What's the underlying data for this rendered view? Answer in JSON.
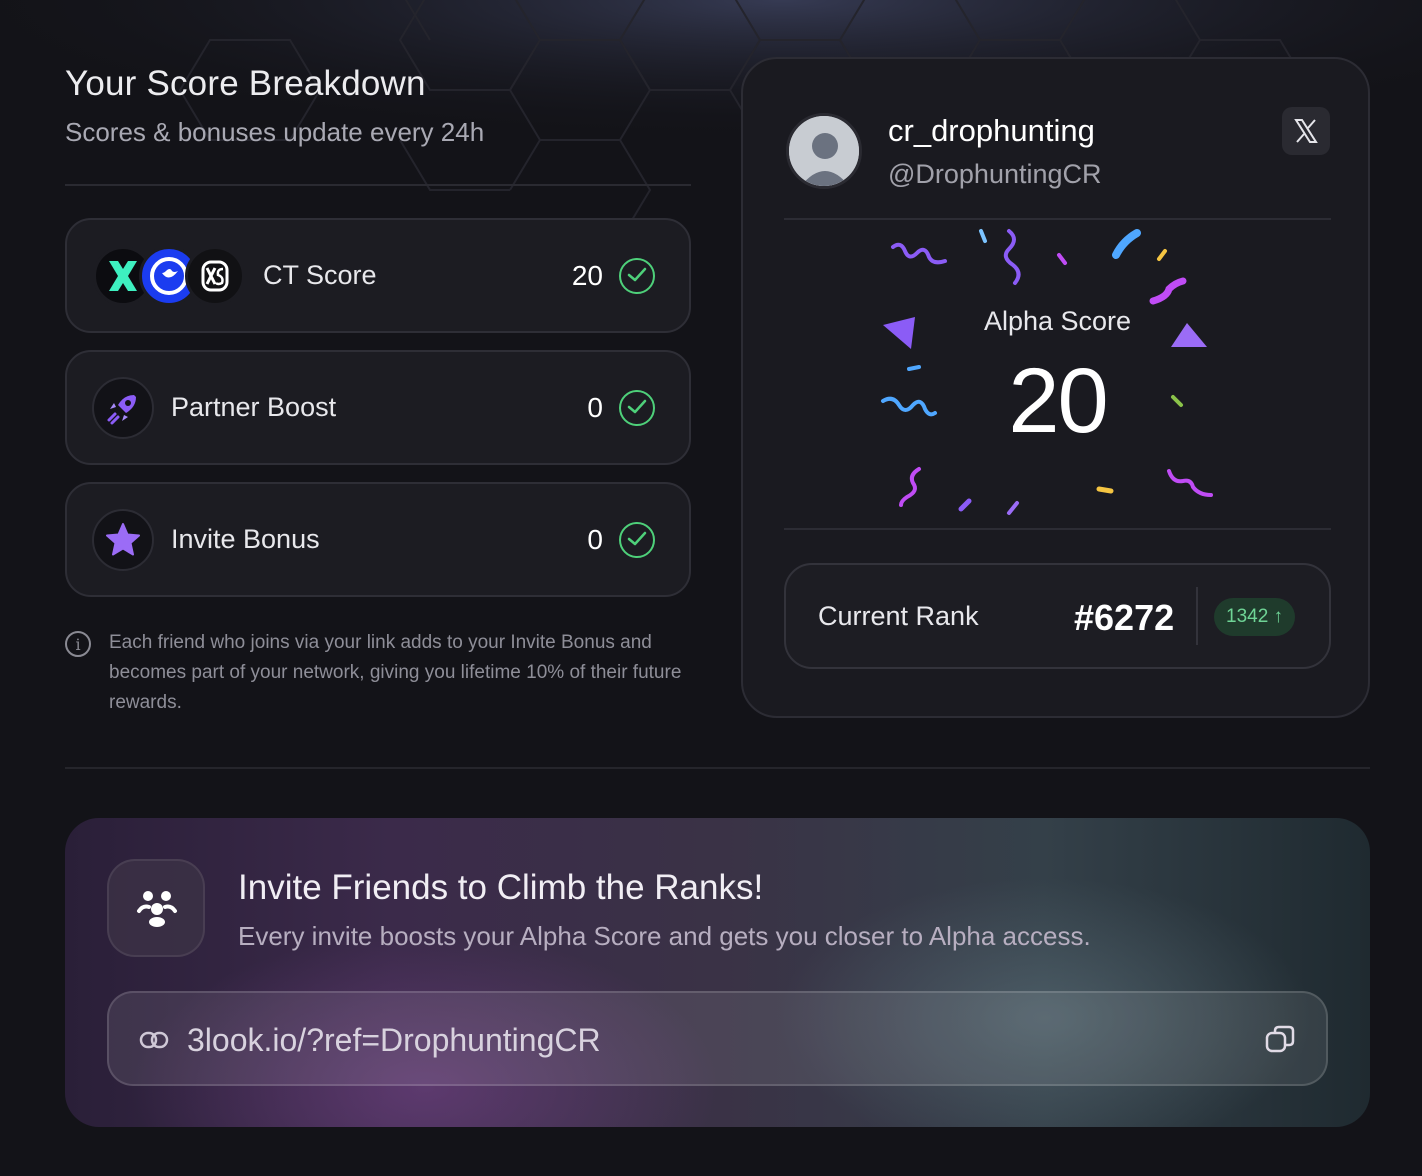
{
  "breakdown": {
    "title": "Your Score Breakdown",
    "subtitle": "Scores & bonuses update every 24h",
    "rows": [
      {
        "label": "CT Score",
        "value": "20"
      },
      {
        "label": "Partner Boost",
        "value": "0"
      },
      {
        "label": "Invite Bonus",
        "value": "0"
      }
    ],
    "info": "Each friend who joins via your link adds to your Invite Bonus and becomes part of your network, giving you lifetime 10% of their future rewards."
  },
  "profile": {
    "username": "cr_drophunting",
    "handle": "@DrophuntingCR",
    "alpha_label": "Alpha Score",
    "alpha_value": "20",
    "rank_label": "Current Rank",
    "rank_value": "#6272",
    "rank_change": "1342 ↑"
  },
  "invite": {
    "title": "Invite Friends to Climb the Ranks!",
    "subtitle": "Every invite boosts your Alpha Score and gets you closer to Alpha access.",
    "link": "3look.io/?ref=DrophuntingCR"
  },
  "colors": {
    "accent_purple": "#8b5cf6",
    "success_green": "#4ed07a",
    "background": "#131318"
  },
  "icons": [
    "x-logo-icon",
    "twitter-icon",
    "xs-logo-icon",
    "rocket-icon",
    "star-icon",
    "check-icon",
    "info-icon",
    "x-brand-icon",
    "users-icon",
    "link-icon",
    "copy-icon"
  ]
}
